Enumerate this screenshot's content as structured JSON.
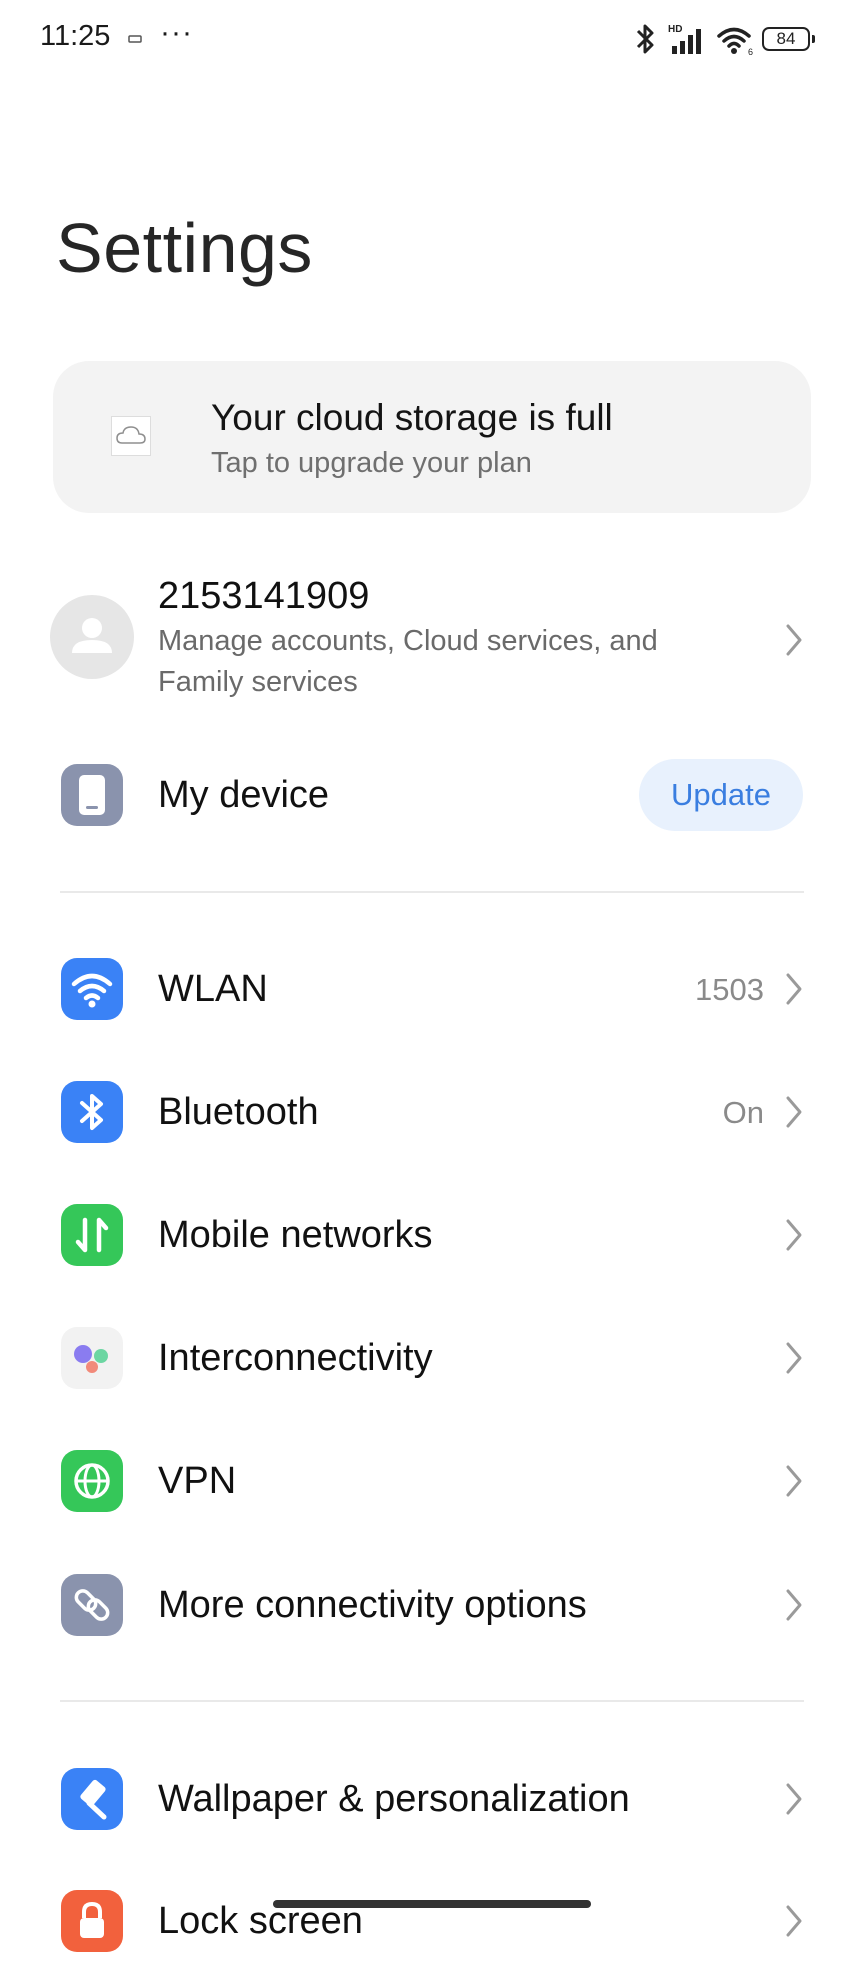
{
  "status_bar": {
    "time": "11:25",
    "dots": "···",
    "battery": "84"
  },
  "page": {
    "title": "Settings"
  },
  "cloud_banner": {
    "title": "Your cloud storage is full",
    "subtitle": "Tap to upgrade your plan"
  },
  "account": {
    "id": "2153141909",
    "description": "Manage accounts, Cloud services, and Family services"
  },
  "device": {
    "label": "My device",
    "button": "Update"
  },
  "connectivity": [
    {
      "label": "WLAN",
      "value": "1503",
      "icon": "wifi-icon",
      "color": "#3a82f6"
    },
    {
      "label": "Bluetooth",
      "value": "On",
      "icon": "bluetooth-icon",
      "color": "#3a82f6"
    },
    {
      "label": "Mobile networks",
      "value": "",
      "icon": "mobile-data-icon",
      "color": "#35c759"
    },
    {
      "label": "Interconnectivity",
      "value": "",
      "icon": "interconnectivity-icon",
      "color": "#f2f2f2"
    },
    {
      "label": "VPN",
      "value": "",
      "icon": "globe-icon",
      "color": "#35c759"
    },
    {
      "label": "More connectivity options",
      "value": "",
      "icon": "link-icon",
      "color": "#8a93ad"
    }
  ],
  "personalization": [
    {
      "label": "Wallpaper & personalization",
      "icon": "brush-icon",
      "color": "#3a82f6"
    },
    {
      "label": "Lock screen",
      "icon": "lock-icon",
      "color": "#f2613d"
    }
  ]
}
